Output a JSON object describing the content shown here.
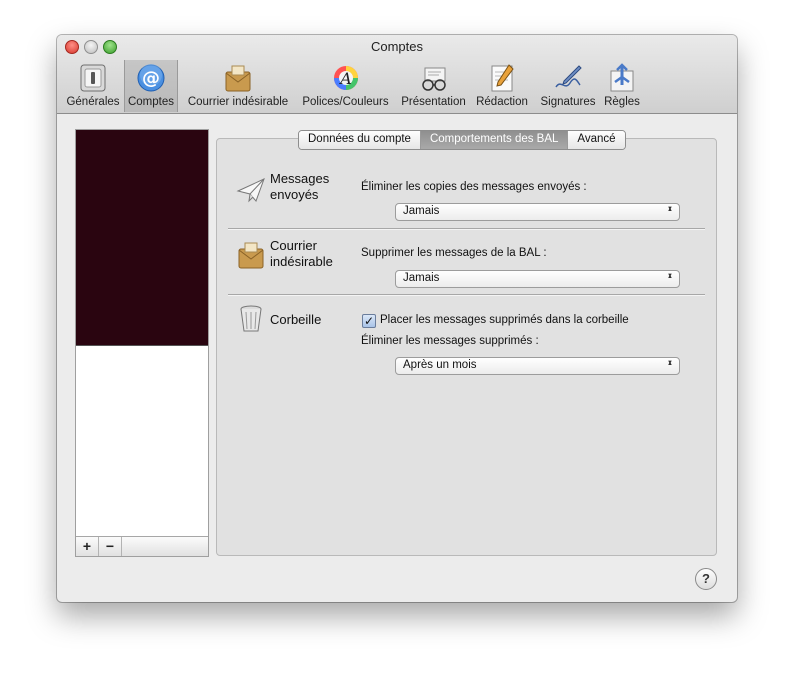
{
  "window": {
    "title": "Comptes"
  },
  "toolbar": {
    "items": [
      {
        "label": "Générales",
        "icon": "general-switch-icon"
      },
      {
        "label": "Comptes",
        "icon": "at-sign-icon",
        "selected": true
      },
      {
        "label": "Courrier indésirable",
        "icon": "junk-mail-icon"
      },
      {
        "label": "Polices/Couleurs",
        "icon": "fonts-colors-icon"
      },
      {
        "label": "Présentation",
        "icon": "viewing-glasses-icon"
      },
      {
        "label": "Rédaction",
        "icon": "composing-pencil-icon"
      },
      {
        "label": "Signatures",
        "icon": "signature-pen-icon"
      },
      {
        "label": "Règles",
        "icon": "rules-arrows-icon"
      }
    ]
  },
  "sidebar": {
    "add_label": "+",
    "remove_label": "−",
    "selected_color": "#2a0510"
  },
  "tabs": [
    {
      "label": "Données du compte"
    },
    {
      "label": "Comportements des BAL",
      "active": true
    },
    {
      "label": "Avancé"
    }
  ],
  "sections": {
    "sent": {
      "title_line1": "Messages",
      "title_line2": "envoyés",
      "description": "Éliminer les copies des messages envoyés :",
      "popup_value": "Jamais"
    },
    "junk": {
      "title_line1": "Courrier",
      "title_line2": "indésirable",
      "description": "Supprimer les messages de la BAL :",
      "popup_value": "Jamais"
    },
    "trash": {
      "title": "Corbeille",
      "checkbox_label": "Placer les messages supprimés dans la corbeille",
      "checkbox_checked": true,
      "description": "Éliminer les messages supprimés :",
      "popup_value": "Après un mois"
    }
  },
  "help_label": "?"
}
